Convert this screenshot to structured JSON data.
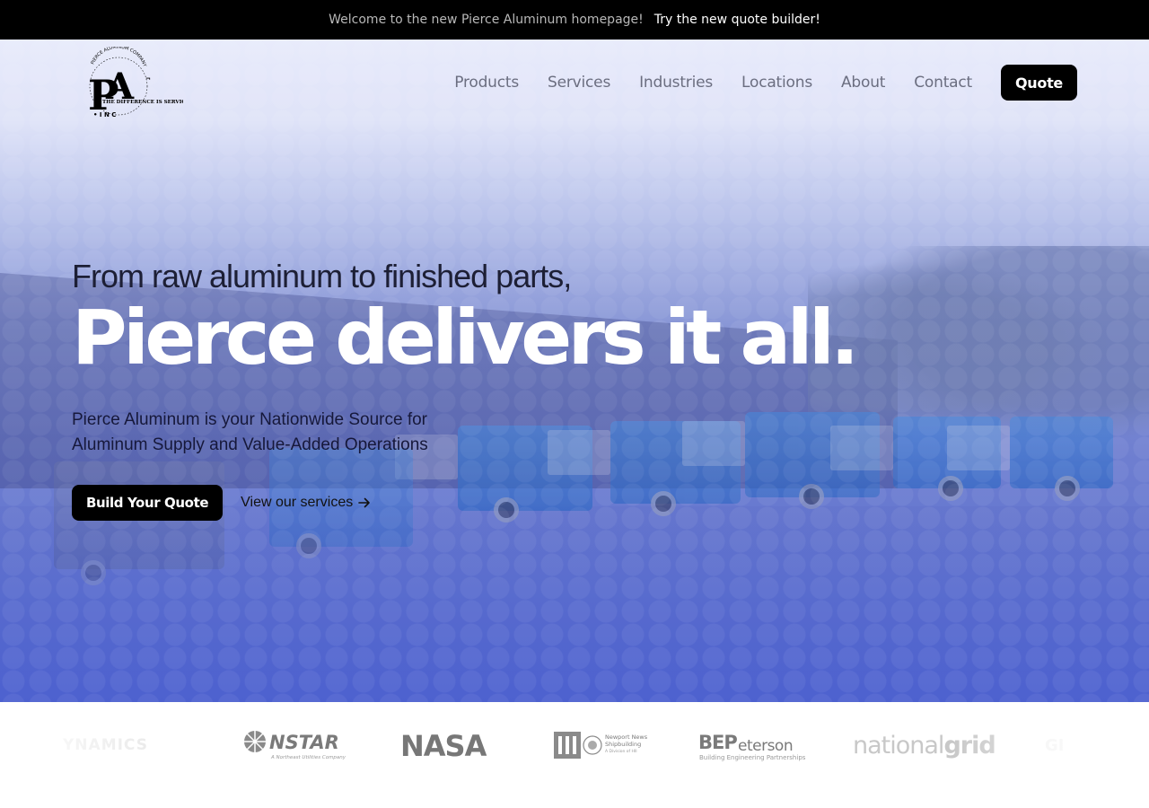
{
  "announcement": {
    "message": "Welcome to the new Pierce Aluminum homepage!",
    "cta": "Try the new quote builder!"
  },
  "logo": {
    "letters": "PA",
    "ring_text": "PIERCE ALUMINUM COMPANY",
    "tagline": "THE DIFFERENCE IS SERVICE",
    "side_text": "INC"
  },
  "nav": {
    "items": [
      "Products",
      "Services",
      "Industries",
      "Locations",
      "About",
      "Contact"
    ],
    "quote_label": "Quote"
  },
  "hero": {
    "kicker": "From raw aluminum to finished parts,",
    "headline": "Pierce delivers it all.",
    "sub_line1": "Pierce Aluminum is your Nationwide Source for",
    "sub_line2": "Aluminum Supply and Value-Added Operations",
    "primary_cta": "Build Your Quote",
    "secondary_cta": "View our services",
    "arrow_icon": "arrow-right-icon"
  },
  "clients": {
    "dynamics": "YNAMICS",
    "nstar": "NSTAR",
    "nstar_sub": "A Northeast Utilities Company",
    "nasa": "NASA",
    "nn_line1": "Newport News",
    "nn_line2": "Shipbuilding",
    "nn_line3": "A Division of HII",
    "bep_bold": "BEP",
    "bep_rest": "eterson",
    "bep_sub": "Building Engineering Partnerships",
    "ng_light": "national",
    "ng_bold": "grid",
    "gen": "GI"
  },
  "colors": {
    "topbar": "#000000",
    "accent_button": "#000000",
    "hero_blue": "#4d61cf",
    "nav_text": "#6b6e80"
  }
}
